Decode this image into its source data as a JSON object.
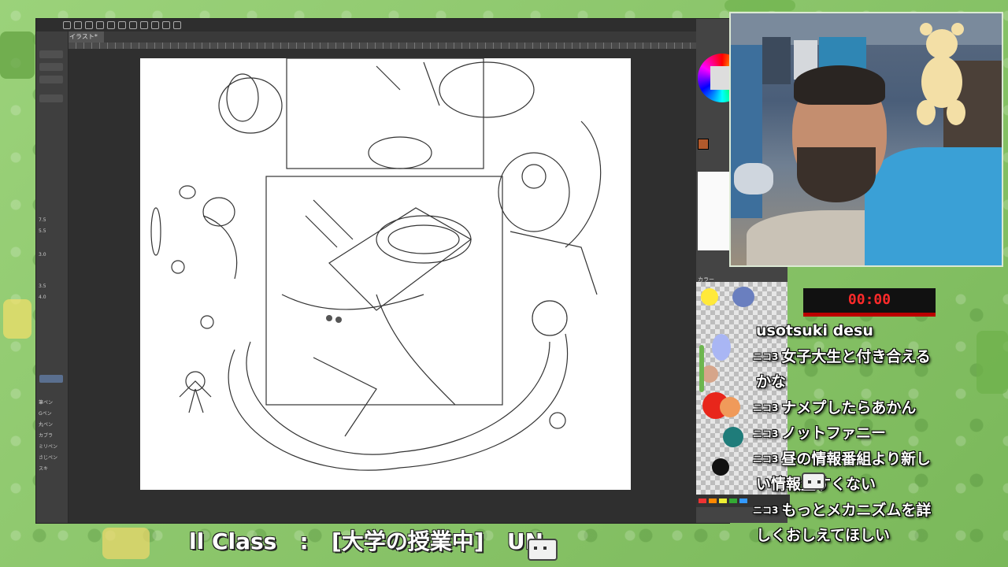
{
  "app": {
    "doc_tab": "イラスト*",
    "tool_labels": [
      "7.5",
      "5.5",
      "3.0",
      "3.5",
      "4.0"
    ],
    "brush_list": [
      "筆ペン",
      "Gペン",
      "丸ペン",
      "カブラ",
      "ミリペン",
      "さじペン",
      "スキ"
    ],
    "palette_label": "カラー"
  },
  "timer": {
    "value": "00:00"
  },
  "chat": {
    "lines": [
      {
        "prefix": "",
        "text": "usotsuki desu"
      },
      {
        "prefix": "ニコ3",
        "text": "女子大生と付き合える"
      },
      {
        "prefix": "",
        "text": "かな"
      },
      {
        "prefix": "ニコ3",
        "text": "ナメプしたらあかん"
      },
      {
        "prefix": "ニコ3",
        "text": "ノットファニー"
      },
      {
        "prefix": "ニコ3",
        "text": "昼の情報番組より新し"
      },
      {
        "prefix": "",
        "text": "い情報量すくない"
      },
      {
        "prefix": "ニコ3",
        "text": "もっとメカニズムを詳"
      },
      {
        "prefix": "",
        "text": "しくおしえてほしい"
      }
    ]
  },
  "ticker": {
    "text": "ll Class   :   [大学の授業中]   UN"
  },
  "colors": {
    "background": "#8fc76a",
    "timer_text": "#ff2a2a",
    "timer_bar": "#b00000",
    "hoodie": "#3aa0d6"
  }
}
